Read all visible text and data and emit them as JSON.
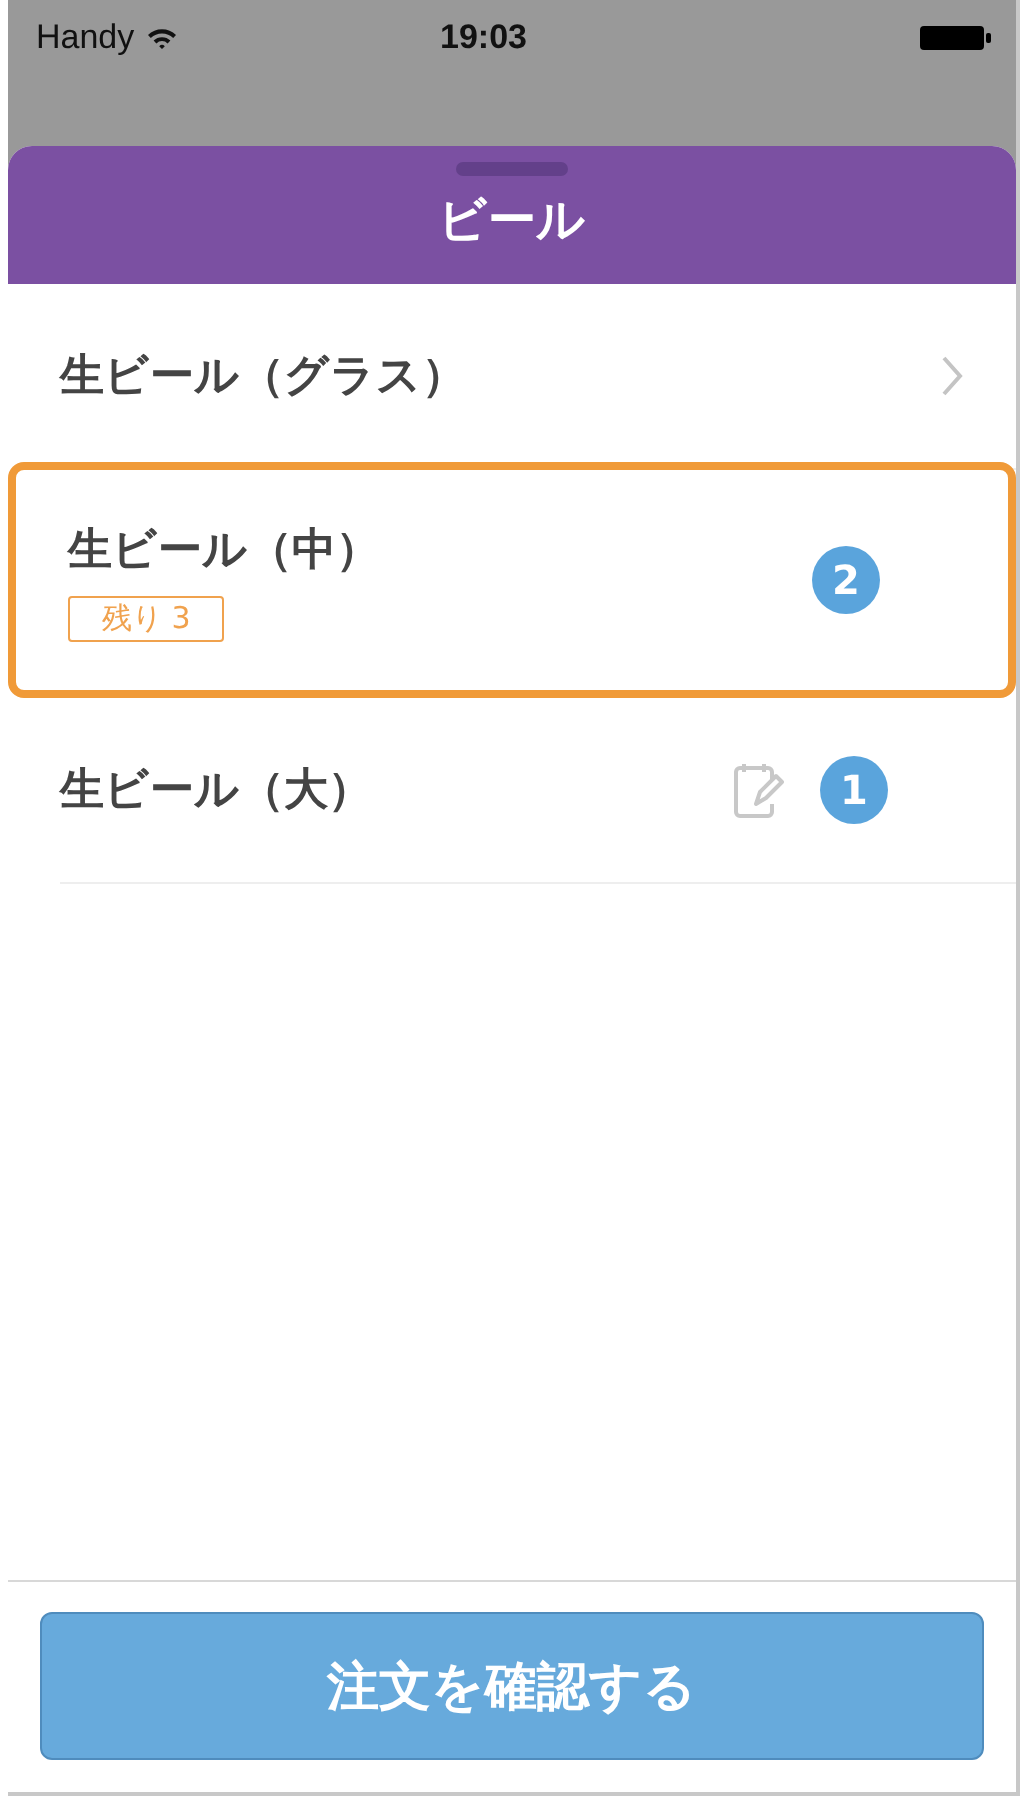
{
  "status_bar": {
    "carrier": "Handy",
    "time": "19:03"
  },
  "sheet": {
    "title": "ビール"
  },
  "items": [
    {
      "name": "生ビール（グラス）",
      "has_submenu": true,
      "has_note": false,
      "selected": false
    },
    {
      "name": "生ビール（中）",
      "remaining": "残り 3",
      "count": "2",
      "has_submenu": false,
      "has_note": false,
      "selected": true
    },
    {
      "name": "生ビール（大）",
      "count": "1",
      "has_submenu": false,
      "has_note": true,
      "selected": false
    }
  ],
  "confirm_button": "注文を確認する"
}
